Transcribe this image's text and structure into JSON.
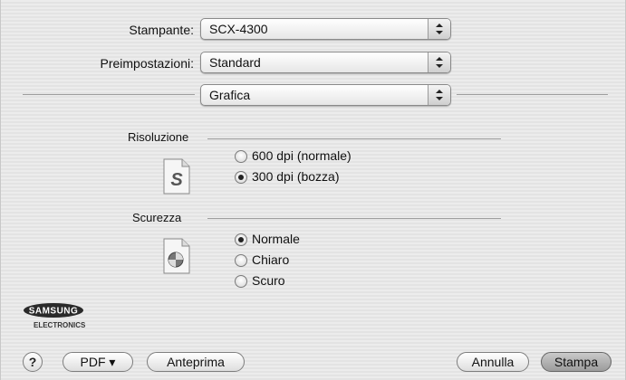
{
  "printer": {
    "label": "Stampante:",
    "value": "SCX-4300"
  },
  "presets": {
    "label": "Preimpostazioni:",
    "value": "Standard"
  },
  "pane": {
    "value": "Grafica"
  },
  "resolution": {
    "title": "Risoluzione",
    "icon_letter": "S",
    "options": [
      {
        "label": "600 dpi (normale)",
        "selected": false
      },
      {
        "label": "300 dpi (bozza)",
        "selected": true
      }
    ]
  },
  "darkness": {
    "title": "Scurezza",
    "options": [
      {
        "label": "Normale",
        "selected": true
      },
      {
        "label": "Chiaro",
        "selected": false
      },
      {
        "label": "Scuro",
        "selected": false
      }
    ]
  },
  "logo": {
    "brand": "SAMSUNG",
    "sub": "ELECTRONICS"
  },
  "buttons": {
    "help": "?",
    "pdf": "PDF ▾",
    "preview": "Anteprima",
    "cancel": "Annulla",
    "print": "Stampa"
  }
}
